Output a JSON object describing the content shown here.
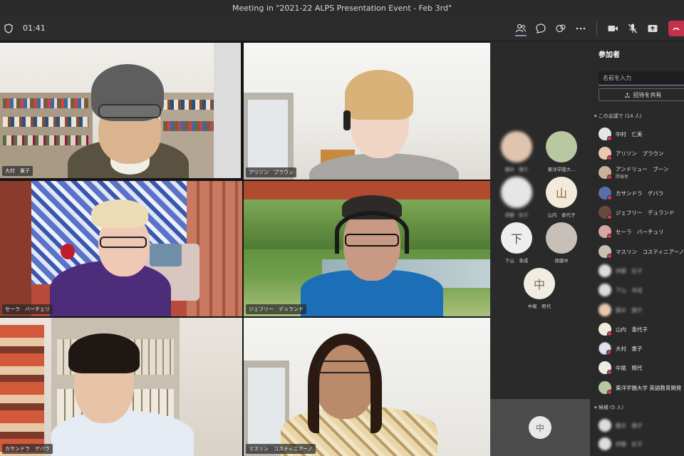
{
  "window": {
    "title": "Meeting in \"2021-22 ALPS Presentation Event - Feb 3rd\""
  },
  "toolbar": {
    "timer": "01:41",
    "buttons": [
      "participants-icon",
      "chat-icon",
      "reactions-icon",
      "more-icon",
      "camera-icon",
      "mic-off-icon",
      "share-icon",
      "leave-icon"
    ]
  },
  "tiles": [
    {
      "name": "大村　憲子"
    },
    {
      "name": "アリソン　ブラウン"
    },
    {
      "name": "セーラ　バーチェリ"
    },
    {
      "name": "ジェフリー　デュランド"
    },
    {
      "name": "カサンドラ　ゲバラ"
    },
    {
      "name": "マスリン　コスティニアーノ"
    }
  ],
  "roster": [
    {
      "initial": "",
      "name": "藤井　雅子"
    },
    {
      "initial": "",
      "name": "東洋学園大..."
    },
    {
      "initial": "",
      "name": "伊藤　彩子"
    },
    {
      "initial": "山",
      "name": "山内　香代子"
    },
    {
      "initial": "下",
      "name": "下山　幸成"
    },
    {
      "initial": "",
      "name": "保健中"
    },
    {
      "initial": "中",
      "name": "中尾　照代"
    }
  ],
  "selfview": {
    "initial": "中"
  },
  "panel": {
    "title": "参加者",
    "search_placeholder": "名前を入力",
    "share_label": "招待を共有",
    "in_meeting_label": "この会議で (14 人)",
    "in_meeting": [
      {
        "name": "中村　仁美",
        "sub": ""
      },
      {
        "name": "アリソン　ブラウン",
        "sub": ""
      },
      {
        "name": "アンドリュー　ブーン",
        "sub": "開催者"
      },
      {
        "name": "カサンドラ　ゲバラ",
        "sub": ""
      },
      {
        "name": "ジェフリー　デュランド",
        "sub": ""
      },
      {
        "name": "セーラ　バーチュリ",
        "sub": ""
      },
      {
        "name": "マスリン　コスティニアーノ",
        "sub": ""
      },
      {
        "name": "伊藤　彩子",
        "sub": ""
      },
      {
        "name": "下山　幸成",
        "sub": ""
      },
      {
        "name": "藤井　雅子",
        "sub": ""
      },
      {
        "name": "山内　香代子",
        "sub": ""
      },
      {
        "name": "大村　憲子",
        "sub": ""
      },
      {
        "name": "中尾　照代",
        "sub": ""
      },
      {
        "name": "東洋学園大学 英語教育開発",
        "sub": ""
      }
    ],
    "suggested_label": "候補 (5 人)",
    "suggested": [
      {
        "name": "藤井　雅子"
      },
      {
        "name": "伊藤　彩子"
      }
    ]
  },
  "colors": {
    "accent": "#8b8cc7",
    "leave": "#c4314b",
    "speaking_border": "#8f9fd8"
  }
}
